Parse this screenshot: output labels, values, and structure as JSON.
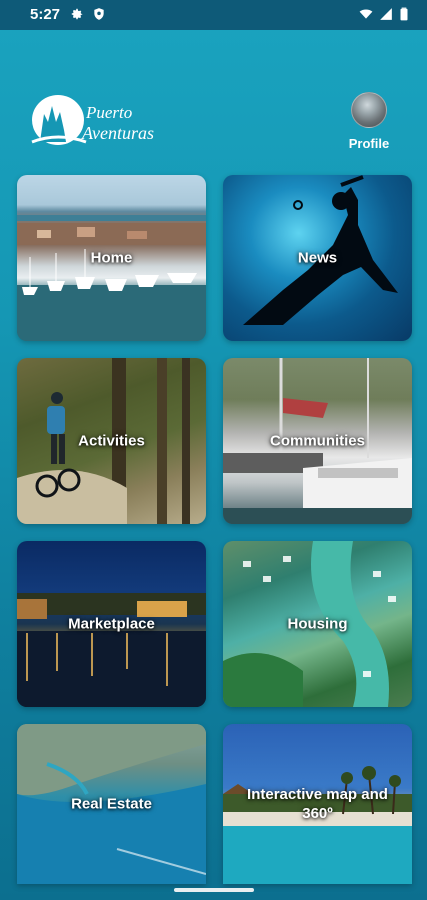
{
  "status_bar": {
    "time": "5:27",
    "left_icons": [
      "gear-icon",
      "shield-icon"
    ],
    "right_icons": [
      "wifi-icon",
      "signal-icon",
      "battery-icon"
    ]
  },
  "header": {
    "logo_text": "Puerto Aventuras",
    "profile_label": "Profile"
  },
  "tiles": [
    {
      "label": "Home"
    },
    {
      "label": "News"
    },
    {
      "label": "Activities"
    },
    {
      "label": "Communities"
    },
    {
      "label": "Marketplace"
    },
    {
      "label": "Housing"
    },
    {
      "label": "Real Estate"
    },
    {
      "label": "Interactive map and 360º"
    }
  ],
  "colors": {
    "background_top": "#1aa3bf",
    "background_bottom": "#0c6f8f",
    "status_bar": "#0e5a78"
  }
}
